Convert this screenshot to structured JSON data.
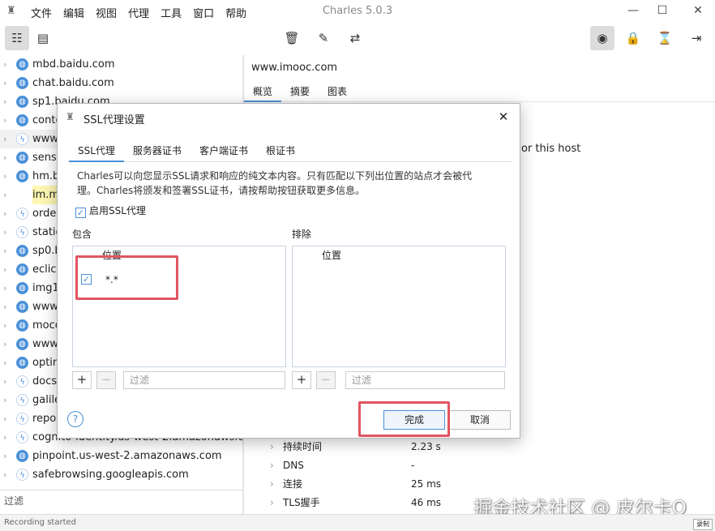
{
  "app": {
    "title": "Charles 5.0.3",
    "menu": [
      "文件",
      "编辑",
      "视图",
      "代理",
      "工具",
      "窗口",
      "帮助"
    ]
  },
  "toolbar": {
    "left_icons": [
      "list-view-icon",
      "detail-view-icon"
    ],
    "center_icons": [
      "trash-icon",
      "edit-icon",
      "repeat-icon"
    ],
    "right_icons": [
      "record-icon",
      "lock-icon",
      "hourglass-icon",
      "arrow-to-line-icon"
    ]
  },
  "tree": {
    "items": [
      {
        "host": "mbd.baidu.com",
        "icon": "globe"
      },
      {
        "host": "chat.baidu.com",
        "icon": "globe"
      },
      {
        "host": "sp1.baidu.com",
        "icon": "globe"
      },
      {
        "host": "conte",
        "icon": "globe"
      },
      {
        "host": "www.",
        "icon": "bolt"
      },
      {
        "host": "senso",
        "icon": "globe"
      },
      {
        "host": "hm.b",
        "icon": "globe"
      },
      {
        "host": "im.m",
        "icon": "record"
      },
      {
        "host": "orde",
        "icon": "bolt"
      },
      {
        "host": "static",
        "icon": "bolt"
      },
      {
        "host": "sp0.b",
        "icon": "globe"
      },
      {
        "host": "eclick",
        "icon": "globe"
      },
      {
        "host": "img1",
        "icon": "globe"
      },
      {
        "host": "www.",
        "icon": "globe"
      },
      {
        "host": "moco",
        "icon": "globe"
      },
      {
        "host": "www.",
        "icon": "globe"
      },
      {
        "host": "optin",
        "icon": "globe"
      },
      {
        "host": "docs.",
        "icon": "bolt"
      },
      {
        "host": "galile",
        "icon": "bolt"
      },
      {
        "host": "repo",
        "icon": "bolt"
      },
      {
        "host": "cognito-identity.us-west-2.amazonaws.com",
        "icon": "bolt"
      },
      {
        "host": "pinpoint.us-west-2.amazonaws.com",
        "icon": "globe"
      },
      {
        "host": "safebrowsing.googleapis.com",
        "icon": "bolt"
      }
    ],
    "filter_label": "过滤"
  },
  "status": {
    "text": "Recording started",
    "button": "录制"
  },
  "right": {
    "host": "www.imooc.com",
    "tabs": [
      "概览",
      "摘要",
      "图表"
    ],
    "partial_note": "or this host",
    "props": [
      {
        "key": "持续时间",
        "value": "2.23 s"
      },
      {
        "key": "DNS",
        "value": "-"
      },
      {
        "key": "连接",
        "value": "25 ms"
      },
      {
        "key": "TLS握手",
        "value": "46 ms"
      }
    ]
  },
  "dialog": {
    "title": "SSL代理设置",
    "tabs": [
      "SSL代理",
      "服务器证书",
      "客户端证书",
      "根证书"
    ],
    "description_line1": "Charles可以向您显示SSL请求和响应的纯文本内容。只有匹配以下列出位置的站点才会被代",
    "description_line2": "理。Charles将颁发和签署SSL证书，请按帮助按钮获取更多信息。",
    "enable_label": "启用SSL代理",
    "enable_checked": true,
    "include": {
      "label": "包含",
      "column": "位置",
      "rows": [
        {
          "checked": true,
          "location": "*.*"
        }
      ],
      "filter_placeholder": "过滤"
    },
    "exclude": {
      "label": "排除",
      "column": "位置",
      "filter_placeholder": "过滤"
    },
    "help_label": "?",
    "ok_label": "完成",
    "cancel_label": "取消"
  },
  "watermark": "掘金技术社区 @ 皮尔卡Q",
  "colors": {
    "accent": "#4a90d9",
    "highlight_box": "#e05560",
    "row_highlight": "#fdf7b3"
  }
}
